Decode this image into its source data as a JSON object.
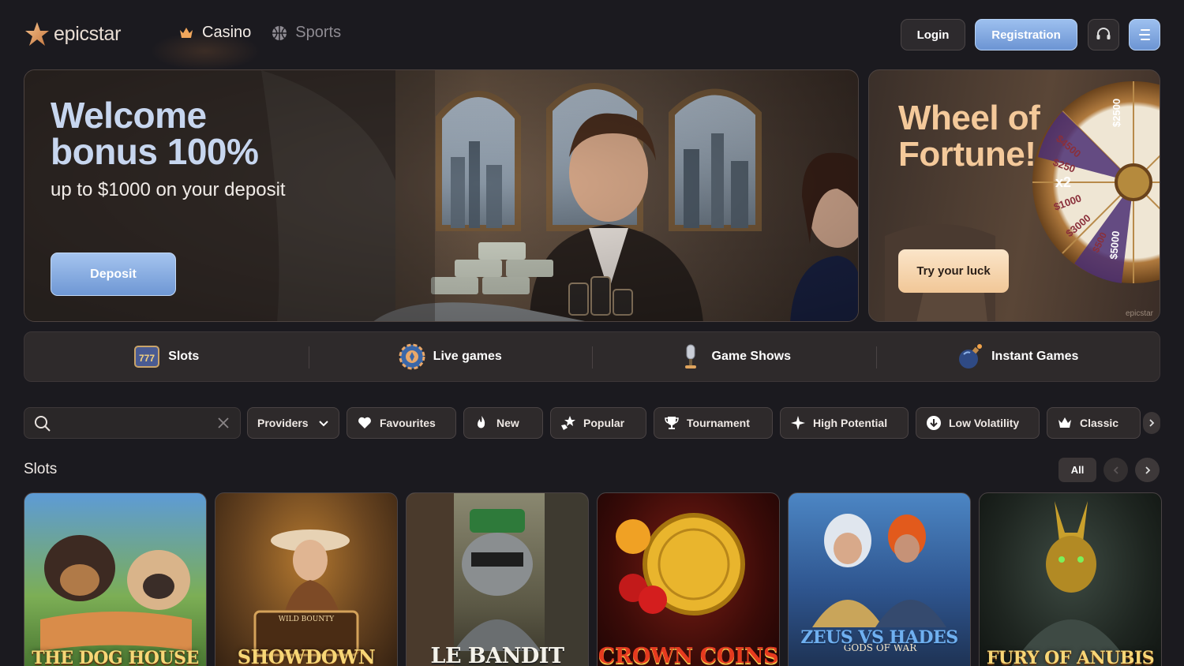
{
  "header": {
    "logo_text": "epicstar",
    "nav": [
      {
        "label": "Casino",
        "icon": "crown-icon",
        "active": true
      },
      {
        "label": "Sports",
        "icon": "basketball-icon",
        "active": false
      }
    ],
    "login_label": "Login",
    "registration_label": "Registration",
    "support_icon": "headset-icon",
    "menu_icon": "hamburger-icon"
  },
  "banners": {
    "main": {
      "title_line1": "Welcome",
      "title_line2": "bonus 100%",
      "subtitle": "up to $1000 on your deposit",
      "button": "Deposit"
    },
    "side": {
      "title_line1": "Wheel of",
      "title_line2": "Fortune!",
      "button": "Try your luck",
      "wheel_labels": [
        "$2500",
        "$4500",
        "$250",
        "x2",
        "$1000",
        "$3000",
        "$5000",
        "$500"
      ],
      "watermark": "epicstar"
    }
  },
  "categories": [
    {
      "label": "Slots",
      "icon": "slots-777-icon"
    },
    {
      "label": "Live games",
      "icon": "poker-chip-icon"
    },
    {
      "label": "Game Shows",
      "icon": "microphone-icon"
    },
    {
      "label": "Instant Games",
      "icon": "bomb-icon"
    }
  ],
  "search": {
    "placeholder": "",
    "value": ""
  },
  "filters": [
    {
      "label": "Providers",
      "icon": "chevron-down-icon"
    },
    {
      "label": "Favourites",
      "icon": "heart-icon"
    },
    {
      "label": "New",
      "icon": "flame-icon"
    },
    {
      "label": "Popular",
      "icon": "star-hand-icon"
    },
    {
      "label": "Tournament",
      "icon": "trophy-icon"
    },
    {
      "label": "High Potential",
      "icon": "sparkle-icon"
    },
    {
      "label": "Low Volatility",
      "icon": "arrow-down-circle-icon"
    },
    {
      "label": "Classic",
      "icon": "crown-icon"
    }
  ],
  "slots": {
    "title": "Slots",
    "all_label": "All",
    "games": [
      {
        "title": "THE DOG HOUSE",
        "colors": [
          "#4a8ec9",
          "#7fb24b"
        ]
      },
      {
        "title": "SHOWDOWN",
        "subtitle": "WILD BOUNTY",
        "colors": [
          "#6a4520",
          "#2e1d10"
        ]
      },
      {
        "title": "LE BANDIT",
        "colors": [
          "#6b6a55",
          "#3a3628"
        ]
      },
      {
        "title": "CROWN COINS",
        "colors": [
          "#5a1410",
          "#1f0606"
        ]
      },
      {
        "title": "ZEUS VS HADES",
        "subtitle": "GODS OF WAR",
        "colors": [
          "#3a6fa8",
          "#1b2c49"
        ]
      },
      {
        "title": "FURY OF ANUBIS",
        "colors": [
          "#2c3a33",
          "#141b17"
        ]
      }
    ]
  },
  "colors": {
    "background": "#1b1a1f",
    "accent_blue": "#8fb3e8",
    "accent_gold": "#f4c99a"
  }
}
